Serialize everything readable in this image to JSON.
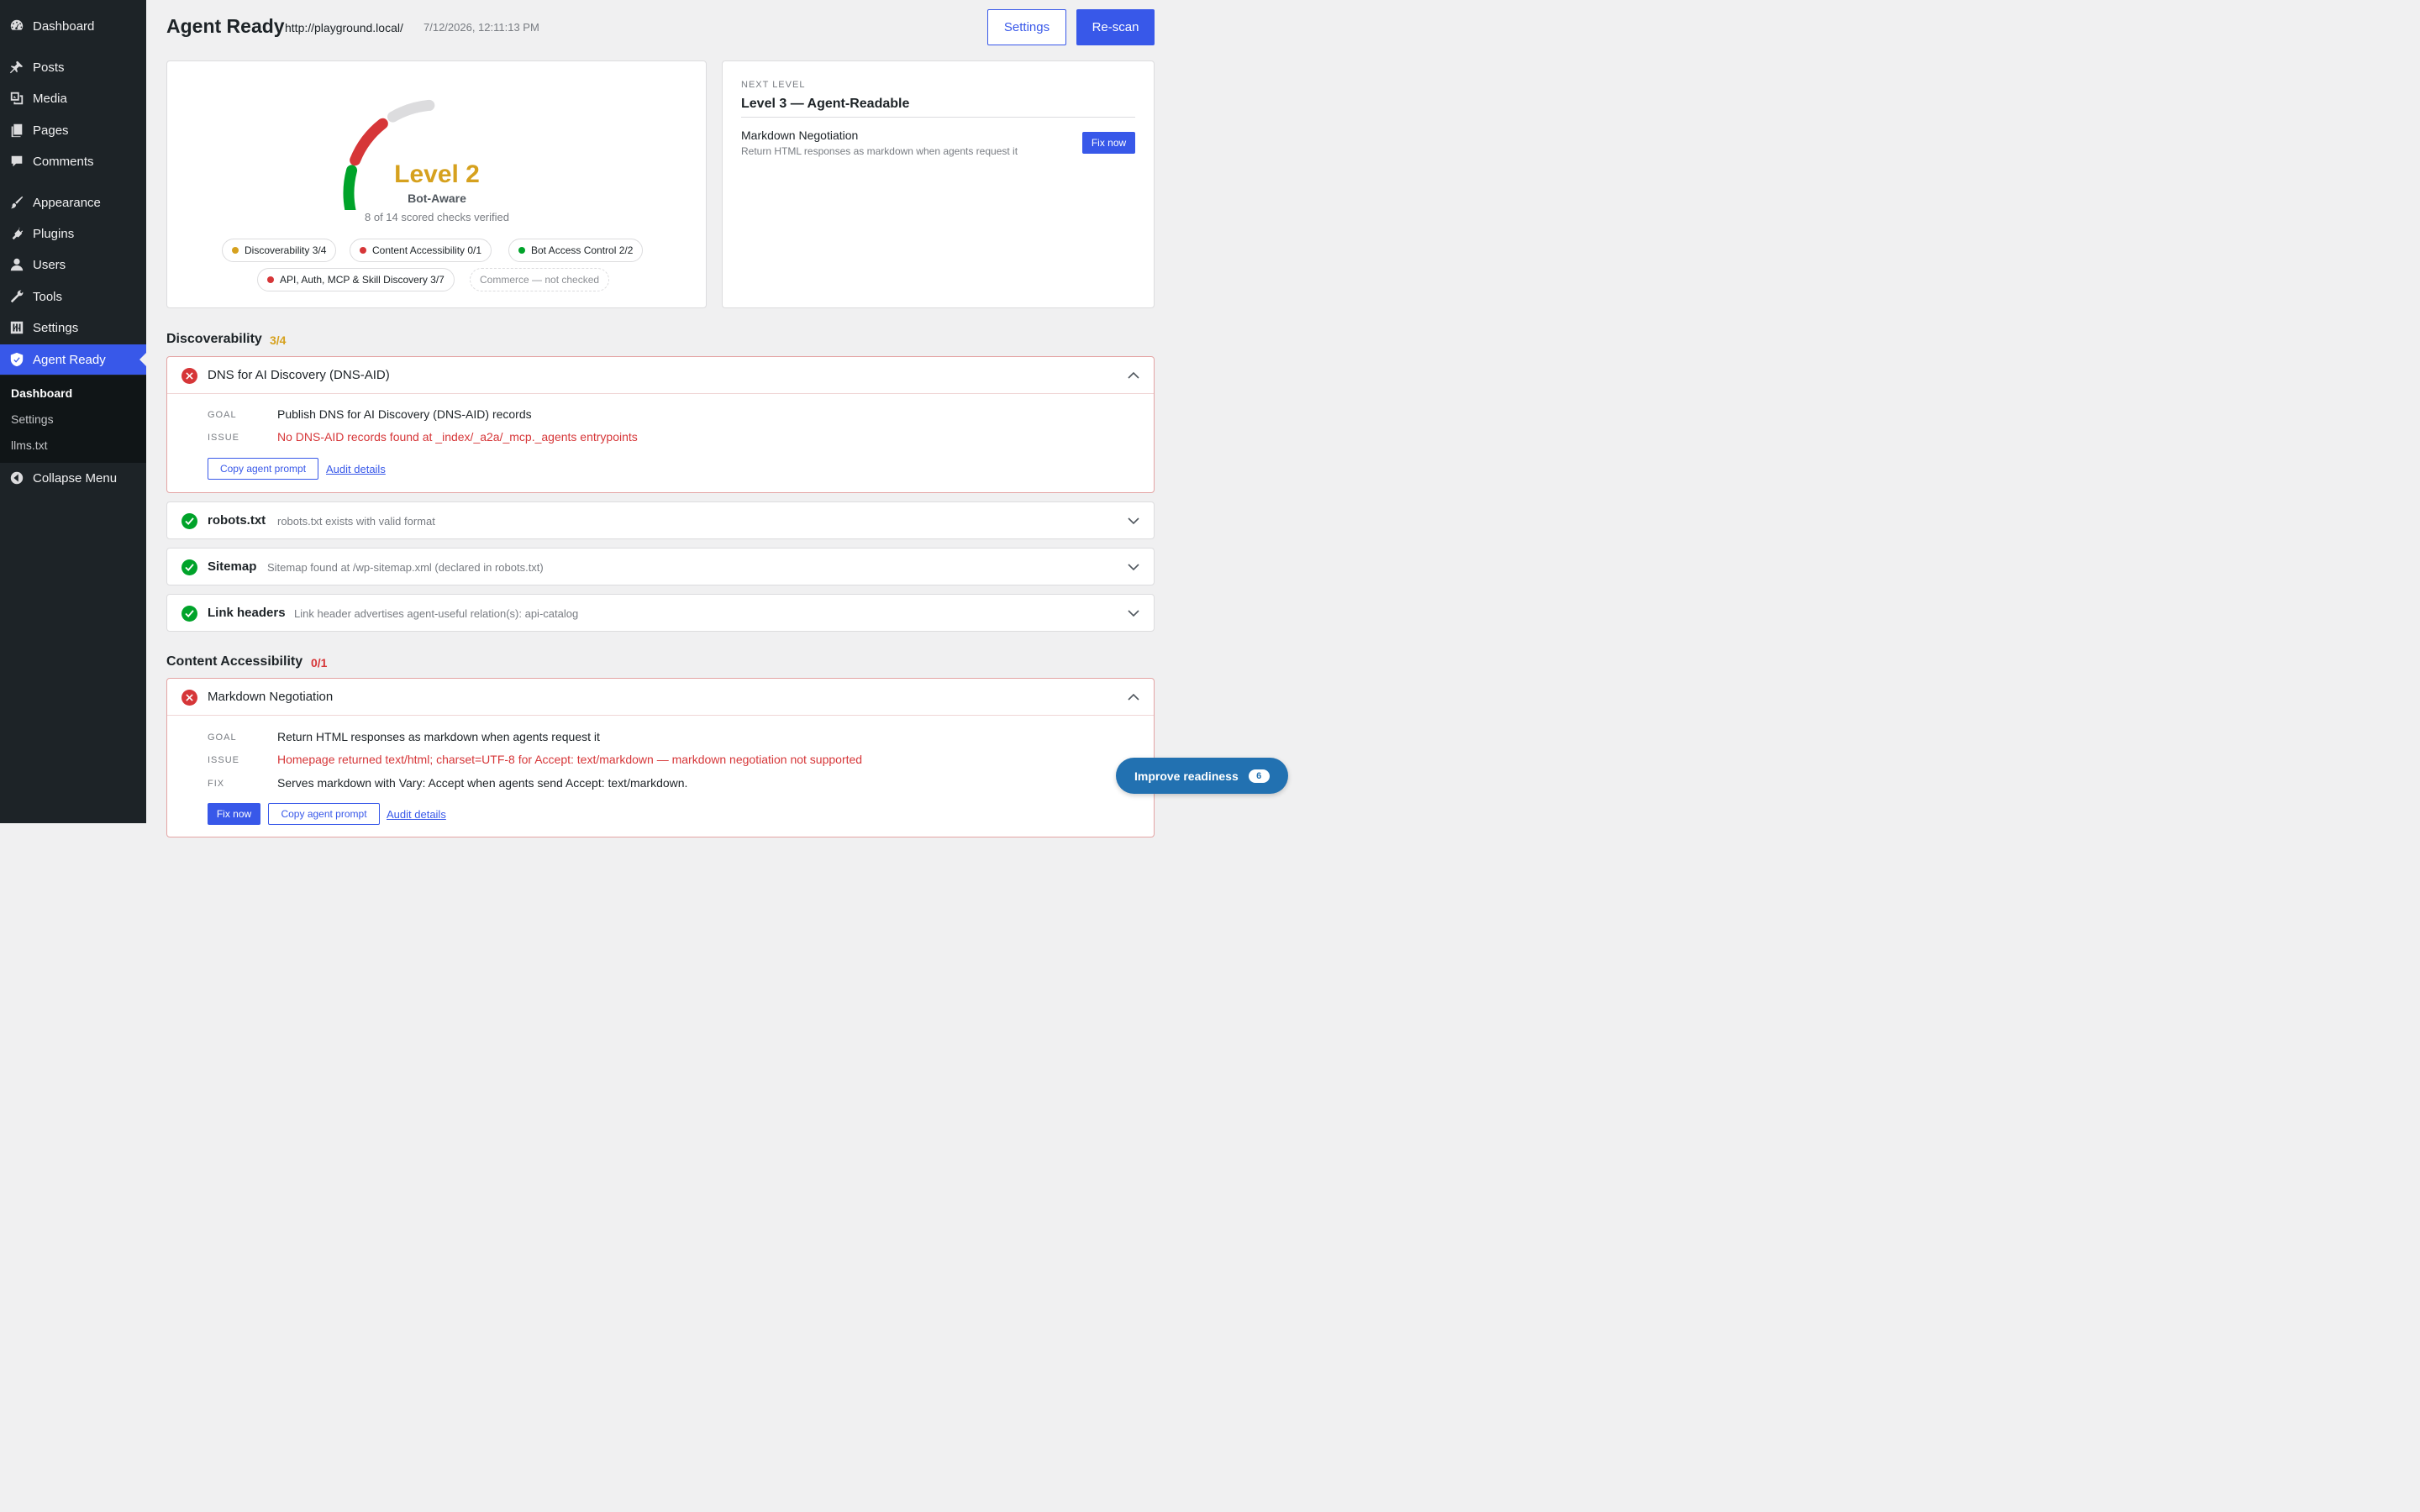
{
  "sidebar": {
    "items": [
      {
        "label": "Dashboard",
        "icon": "dashboard-icon"
      },
      {
        "label": "Posts",
        "icon": "pin-icon"
      },
      {
        "label": "Media",
        "icon": "media-icon"
      },
      {
        "label": "Pages",
        "icon": "pages-icon"
      },
      {
        "label": "Comments",
        "icon": "comment-icon"
      },
      {
        "label": "Appearance",
        "icon": "brush-icon"
      },
      {
        "label": "Plugins",
        "icon": "plug-icon"
      },
      {
        "label": "Users",
        "icon": "user-icon"
      },
      {
        "label": "Tools",
        "icon": "wrench-icon"
      },
      {
        "label": "Settings",
        "icon": "sliders-icon"
      },
      {
        "label": "Agent Ready",
        "icon": "shield-icon"
      }
    ],
    "submenu": [
      "Dashboard",
      "Settings",
      "llms.txt"
    ],
    "collapse": "Collapse Menu"
  },
  "header": {
    "title": "Agent Ready",
    "url": "http://playground.local/",
    "timestamp": "7/12/2026, 12:11:13 PM",
    "settings_label": "Settings",
    "rescan_label": "Re-scan"
  },
  "score": {
    "level": "Level 2",
    "level_name": "Bot-Aware",
    "checks_text": "8 of 14 scored checks verified",
    "segments": [
      {
        "color": "#d6a11e"
      },
      {
        "color": "#dcdcde"
      },
      {
        "color": "#00a32a"
      },
      {
        "color": "#d63638"
      },
      {
        "color": "#dcdcde"
      }
    ],
    "categories": [
      {
        "label": "Discoverability 3/4",
        "color": "#d6a11e"
      },
      {
        "label": "Content Accessibility 0/1",
        "color": "#d63638"
      },
      {
        "label": "Bot Access Control 2/2",
        "color": "#00a32a"
      },
      {
        "label": "API, Auth, MCP & Skill Discovery 3/7",
        "color": "#d63638"
      },
      {
        "label": "Commerce — not checked",
        "color": ""
      }
    ]
  },
  "next_level": {
    "label": "NEXT LEVEL",
    "title": "Level 3 — Agent-Readable",
    "item_title": "Markdown Negotiation",
    "item_desc": "Return HTML responses as markdown when agents request it",
    "fix_label": "Fix now"
  },
  "sections": {
    "discoverability": {
      "title": "Discoverability",
      "score": "3/4",
      "score_color": "#d6a11e",
      "checks": [
        {
          "name": "DNS for AI Discovery (DNS-AID)",
          "status": "fail",
          "goal_label": "GOAL",
          "goal": "Publish DNS for AI Discovery (DNS-AID) records",
          "issue_label": "ISSUE",
          "issue": "No DNS-AID records found at _index/_a2a/_mcp._agents entrypoints",
          "copy_label": "Copy agent prompt",
          "audit_label": "Audit details"
        },
        {
          "name": "robots.txt",
          "status": "pass",
          "summary": "robots.txt exists with valid format"
        },
        {
          "name": "Sitemap",
          "status": "pass",
          "summary": "Sitemap found at /wp-sitemap.xml (declared in robots.txt)"
        },
        {
          "name": "Link headers",
          "status": "pass",
          "summary": "Link header advertises agent-useful relation(s): api-catalog"
        }
      ]
    },
    "content": {
      "title": "Content Accessibility",
      "score": "0/1",
      "score_color": "#d63638",
      "checks": [
        {
          "name": "Markdown Negotiation",
          "status": "fail",
          "goal_label": "GOAL",
          "goal": "Return HTML responses as markdown when agents request it",
          "issue_label": "ISSUE",
          "issue": "Homepage returned text/html; charset=UTF-8 for Accept: text/markdown — markdown negotiation not supported",
          "fix_label_kv": "FIX",
          "fix": "Serves markdown with Vary: Accept when agents send Accept: text/markdown.",
          "fix_now_label": "Fix now",
          "copy_label": "Copy agent prompt",
          "audit_label": "Audit details"
        }
      ]
    }
  },
  "floating": {
    "label": "Improve readiness",
    "count": "6"
  }
}
